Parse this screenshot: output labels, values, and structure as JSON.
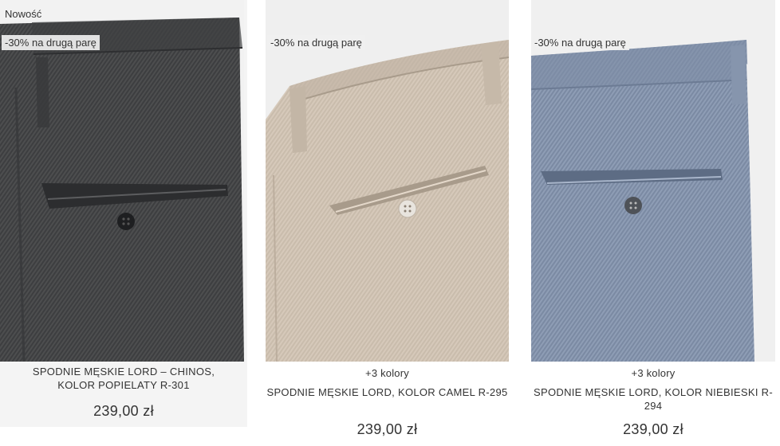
{
  "products": [
    {
      "badge_new": "Nowość",
      "badge_promo": "-30% na drugą parę",
      "colors_more": "",
      "name": "SPODNIE MĘSKIE LORD – CHINOS, KOLOR POPIELATY R-301",
      "price": "239,00 zł",
      "fabric_color": "#4a4b4c"
    },
    {
      "badge_promo": "-30% na drugą parę",
      "colors_more": "+3 kolory",
      "name": "SPODNIE MĘSKIE LORD, KOLOR CAMEL R-295",
      "price": "239,00 zł",
      "fabric_color": "#d4c7b8"
    },
    {
      "badge_promo": "-30% na drugą parę",
      "colors_more": "+3 kolory",
      "name": "SPODNIE MĘSKIE LORD, KOLOR NIEBIESKI R-294",
      "price": "239,00 zł",
      "fabric_color": "#8a9ab3"
    }
  ]
}
